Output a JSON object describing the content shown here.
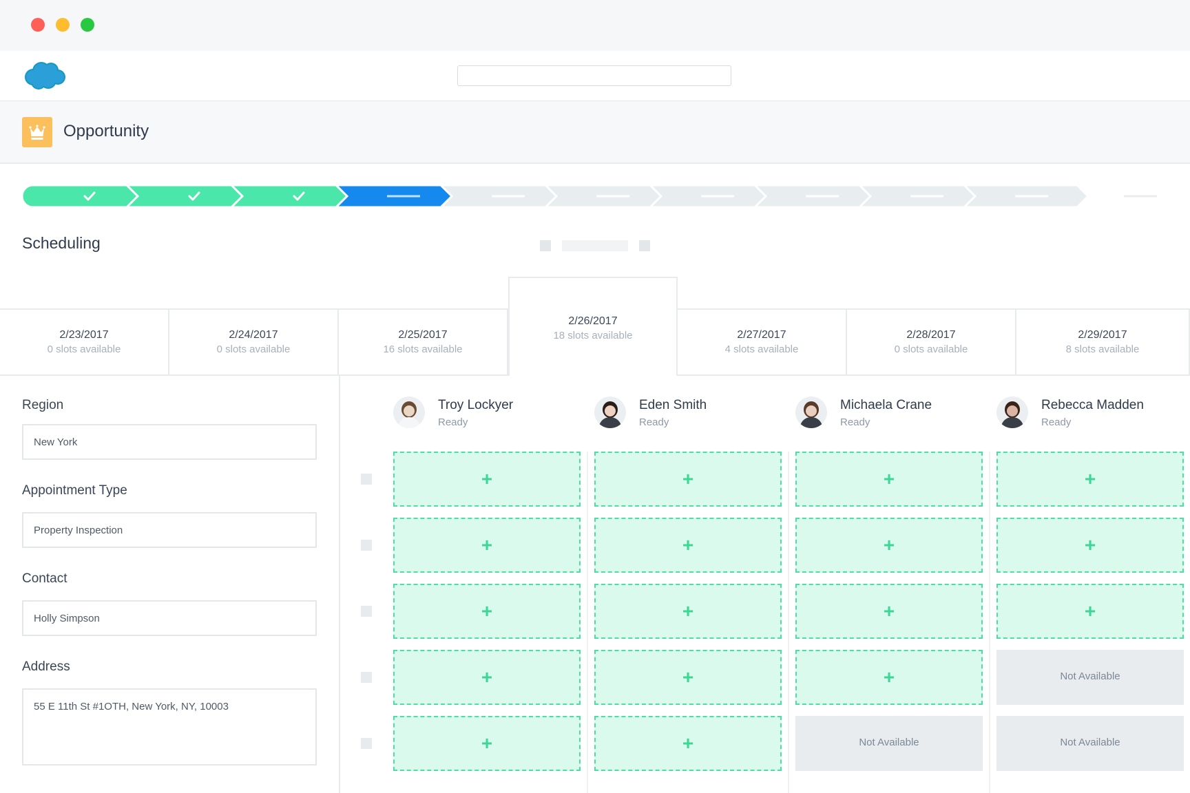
{
  "window": {
    "dots": [
      {
        "name": "close-dot",
        "color": "#fe5f57"
      },
      {
        "name": "minimize-dot",
        "color": "#febc2e"
      },
      {
        "name": "maximize-dot",
        "color": "#28c840"
      }
    ]
  },
  "appbar": {
    "logo_icon": "salesforce-cloud-icon",
    "search": {
      "placeholder": "",
      "value": ""
    }
  },
  "header": {
    "icon": "crown-icon",
    "icon_color": "#fbc05c",
    "title": "Opportunity"
  },
  "path": {
    "steps": [
      {
        "state": "complete"
      },
      {
        "state": "complete"
      },
      {
        "state": "complete"
      },
      {
        "state": "current"
      },
      {
        "state": "incomplete"
      },
      {
        "state": "incomplete"
      },
      {
        "state": "incomplete"
      },
      {
        "state": "incomplete"
      },
      {
        "state": "incomplete"
      },
      {
        "state": "incomplete"
      }
    ],
    "colors": {
      "complete": "#4be6a9",
      "current": "#1589ee",
      "incomplete": "#e8edf0"
    }
  },
  "section": {
    "title": "Scheduling"
  },
  "dates": [
    {
      "date": "2/23/2017",
      "slots": "0 slots available",
      "active": false
    },
    {
      "date": "2/24/2017",
      "slots": "0 slots available",
      "active": false
    },
    {
      "date": "2/25/2017",
      "slots": "16 slots available",
      "active": false
    },
    {
      "date": "2/26/2017",
      "slots": "18 slots available",
      "active": true
    },
    {
      "date": "2/27/2017",
      "slots": "4 slots available",
      "active": false
    },
    {
      "date": "2/28/2017",
      "slots": "0 slots available",
      "active": false
    },
    {
      "date": "2/29/2017",
      "slots": "8 slots available",
      "active": false
    }
  ],
  "form": {
    "region": {
      "label": "Region",
      "value": "New York"
    },
    "appointment_type": {
      "label": "Appointment Type",
      "value": "Property Inspection"
    },
    "contact": {
      "label": "Contact",
      "value": "Holly Simpson"
    },
    "address": {
      "label": "Address",
      "value": "55 E 11th St #1OTH, New York, NY, 10003"
    }
  },
  "people": [
    {
      "name": "Troy Lockyer",
      "status": "Ready",
      "slots": [
        "open",
        "open",
        "open",
        "open",
        "open"
      ]
    },
    {
      "name": "Eden Smith",
      "status": "Ready",
      "slots": [
        "open",
        "open",
        "open",
        "open",
        "open"
      ]
    },
    {
      "name": "Michaela Crane",
      "status": "Ready",
      "slots": [
        "open",
        "open",
        "open",
        "open",
        "na"
      ]
    },
    {
      "name": "Rebecca Madden",
      "status": "Ready",
      "slots": [
        "open",
        "open",
        "open",
        "na",
        "na"
      ]
    }
  ],
  "slot_labels": {
    "open": "+",
    "na": "Not Available"
  }
}
